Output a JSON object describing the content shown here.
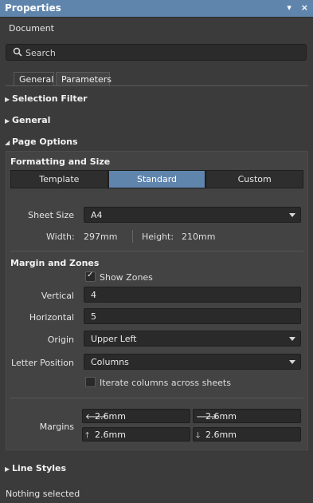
{
  "window": {
    "title": "Properties",
    "pin_glyph": "▾",
    "close_glyph": "×"
  },
  "subtitle": "Document",
  "search": {
    "placeholder": "Search"
  },
  "tabs": [
    {
      "label": "General"
    },
    {
      "label": "Parameters"
    }
  ],
  "sections": {
    "selection_filter": "Selection Filter",
    "general": "General",
    "page_options": "Page Options",
    "line_styles": "Line Styles"
  },
  "arrows": {
    "collapsed": "▶",
    "expanded": "◢"
  },
  "formatting": {
    "title": "Formatting and Size",
    "buttons": [
      "Template",
      "Standard",
      "Custom"
    ],
    "active": "Standard"
  },
  "sheet": {
    "size_label": "Sheet Size",
    "size_value": "A4",
    "width_label": "Width:",
    "width_value": "297mm",
    "height_label": "Height:",
    "height_value": "210mm"
  },
  "margin_zones": {
    "title": "Margin and Zones",
    "show_zones_label": "Show Zones",
    "show_zones_checked": true,
    "vertical_label": "Vertical",
    "vertical_value": "4",
    "horizontal_label": "Horizontal",
    "horizontal_value": "5",
    "origin_label": "Origin",
    "origin_value": "Upper Left",
    "letter_position_label": "Letter Position",
    "letter_position_value": "Columns",
    "iterate_label": "Iterate columns across sheets",
    "iterate_checked": false
  },
  "margins": {
    "label": "Margins",
    "left": "2.6mm",
    "right": "2.6mm",
    "top": "2.6mm",
    "bottom": "2.6mm"
  },
  "status": "Nothing selected",
  "colors": {
    "accent": "#5f85ad",
    "panel_bg": "#3b3b3b"
  }
}
